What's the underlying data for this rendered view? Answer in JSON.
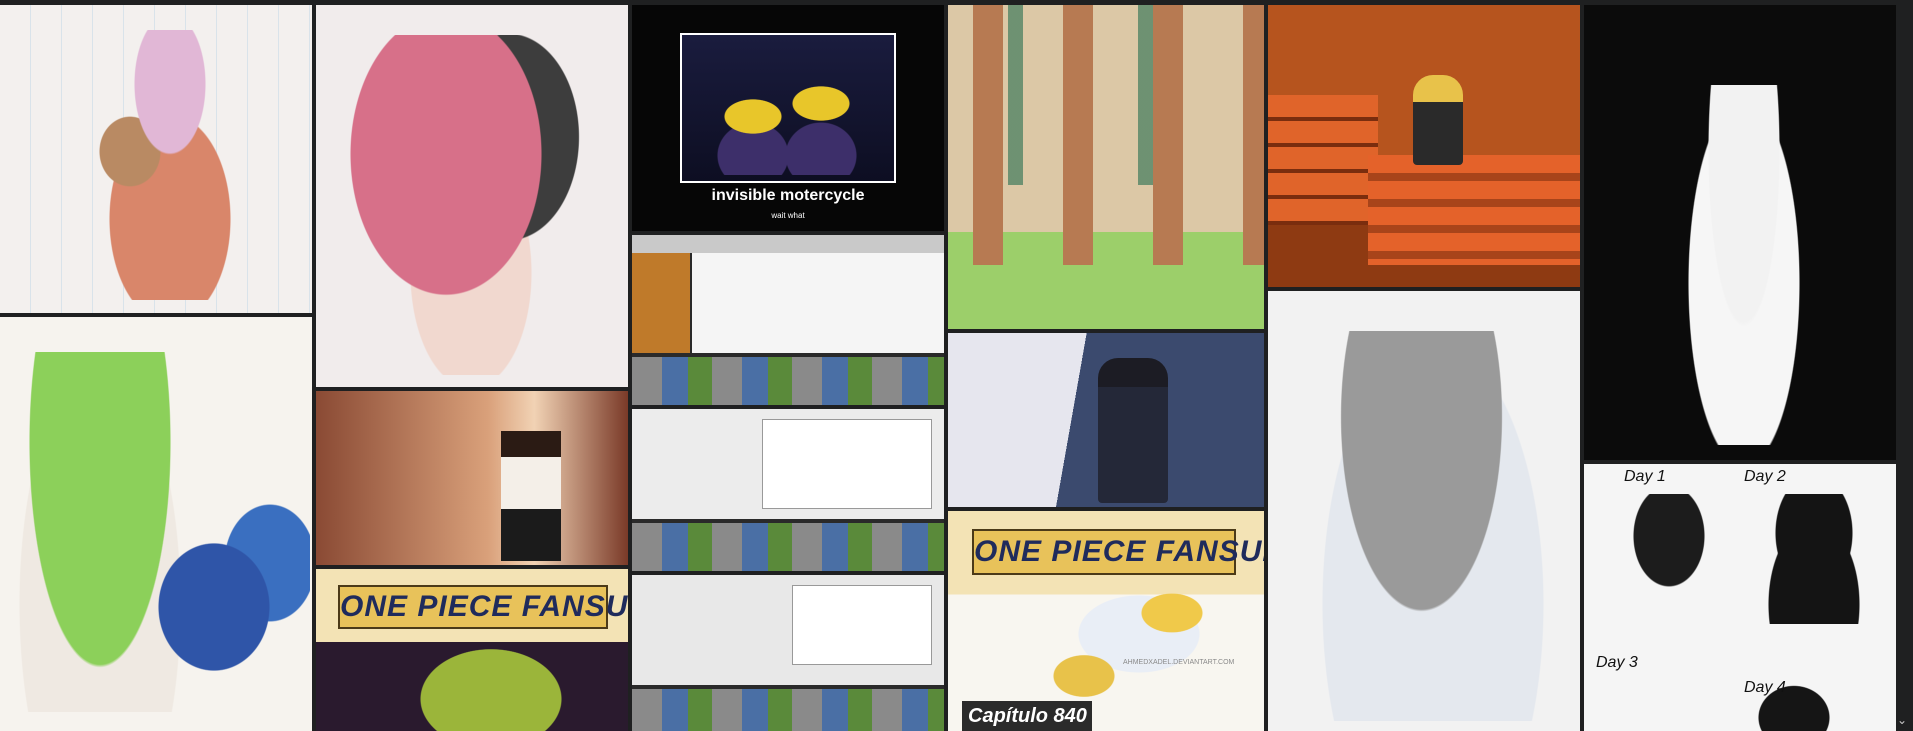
{
  "gallery": {
    "tiles": [
      {
        "id": "t1",
        "alt": "pencil sketch of two characters on lined paper",
        "colors": [
          "#f2efec",
          "#e6d9dc"
        ]
      },
      {
        "id": "t2",
        "alt": "character with pink-black hair and mask",
        "colors": [
          "#f0e9ea",
          "#d88a9a"
        ]
      },
      {
        "id": "t3",
        "alt": "motivational poster",
        "caption_title": "invisible motercycle",
        "caption_sub": "wait what",
        "colors": [
          "#050505",
          "#1b1b3a"
        ]
      },
      {
        "id": "t4",
        "alt": "figure in a forest of tall trees",
        "colors": [
          "#d9c7a8",
          "#6e9a7c"
        ]
      },
      {
        "id": "t5",
        "alt": "3D classroom with orange desks",
        "colors": [
          "#c8521e",
          "#8a3a12"
        ]
      },
      {
        "id": "t6",
        "alt": "black and white drawing of a girl",
        "colors": [
          "#0a0a0a",
          "#f4f4f4"
        ]
      },
      {
        "id": "t7",
        "alt": "character with green hair and blue dragon",
        "colors": [
          "#f6f3ee",
          "#7fc25a"
        ]
      },
      {
        "id": "t8",
        "alt": "3D characters in a hallway",
        "colors": [
          "#6e3b2a",
          "#e8c8a8"
        ]
      },
      {
        "id": "t9",
        "alt": "software screenshot",
        "colors": [
          "#d6d6d6",
          "#3a3a3a"
        ]
      },
      {
        "id": "t10",
        "alt": "3D character in a school corridor",
        "colors": [
          "#3b4a6a",
          "#c8c8d8"
        ]
      },
      {
        "id": "t11",
        "alt": "grey-haired character sketch",
        "colors": [
          "#f2f2f2",
          "#a8a8a8"
        ]
      },
      {
        "id": "t12",
        "alt": "software screenshot",
        "colors": [
          "#e2e2e2",
          "#3a3a3a"
        ]
      },
      {
        "id": "t13",
        "alt": "black and white comic panels",
        "caption_labels": [
          "Day 1",
          "Day 2",
          "Day 3",
          "Day 4"
        ],
        "colors": [
          "#f4f4f4",
          "#111111"
        ]
      },
      {
        "id": "t14",
        "alt": "One Piece fansub cover",
        "caption_title": "ONE PIECE FANSUB",
        "colors": [
          "#f0d8a0",
          "#5a2a6a"
        ]
      },
      {
        "id": "t15",
        "alt": "software screenshot",
        "colors": [
          "#dcdcdc",
          "#3a3a3a"
        ]
      },
      {
        "id": "t16",
        "alt": "One Piece fansub cover",
        "caption_title": "ONE PIECE FANSUB",
        "caption_sub": "Capítulo 840",
        "watermark": "AHMEDXADEL.DEVIANTART.COM",
        "colors": [
          "#f5f0e6",
          "#2a2a2a"
        ]
      }
    ],
    "scroll_icon": "chevron-down-icon",
    "scroll_glyph": "⌄"
  }
}
